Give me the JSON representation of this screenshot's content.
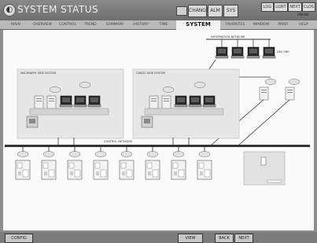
{
  "app": {
    "title": "SYSTEM STATUS"
  },
  "toolbar": {
    "btn1": "CHANGE",
    "btn2": "ALM",
    "btn3": "SYS"
  },
  "right_panel": {
    "btn1": "LOG",
    "btn2": "LGNT",
    "btn3": "NEXT",
    "btn4": "CLOS",
    "sub": "ONLINE"
  },
  "nav": {
    "tabs": [
      {
        "label": "MAIN"
      },
      {
        "label": "OVERVIEW"
      },
      {
        "label": "CONTROL"
      },
      {
        "label": "TREND"
      },
      {
        "label": "SUMMARY"
      },
      {
        "label": "HISTORY"
      },
      {
        "label": "TIME"
      },
      {
        "label": "SYSTEM"
      },
      {
        "label": "FAVORITES"
      },
      {
        "label": "WINDOW"
      },
      {
        "label": "PRINT"
      },
      {
        "label": "HELP"
      }
    ]
  },
  "diagram": {
    "info_network_label": "INFORMATION NETWORK",
    "left_system_label": "MACHINERY SIDE SYSTEM",
    "right_system_label": "CARGO SIDE SYSTEM",
    "control_network_label": "CONTROL NETWORK",
    "terminal_label": "EWS ONH"
  },
  "bottom": {
    "left_btn": "CONFIG",
    "btn_view": "VIEW",
    "btn_back": "BACK",
    "btn_next": "NEXT"
  }
}
